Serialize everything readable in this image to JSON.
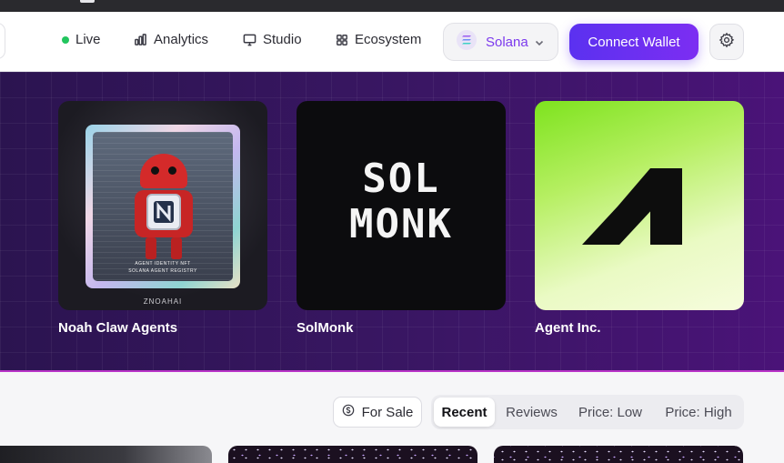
{
  "nav": {
    "live_label": "Live",
    "analytics_label": "Analytics",
    "studio_label": "Studio",
    "ecosystem_label": "Ecosystem",
    "chain_selected": "Solana",
    "connect_label": "Connect Wallet"
  },
  "featured": [
    {
      "title": "Noah Claw Agents",
      "art": {
        "caption_line1": "AGENT IDENTITY NFT",
        "caption_line2": "SOLANA AGENT REGISTRY",
        "watermark": "ZNOAHAI"
      }
    },
    {
      "title": "SolMonk",
      "art": {
        "line1": "SOL",
        "line2": "MONK"
      }
    },
    {
      "title": "Agent Inc."
    }
  ],
  "filters": {
    "for_sale_label": "For Sale",
    "sort_options": [
      "Recent",
      "Reviews",
      "Price: Low",
      "Price: High"
    ],
    "active_sort": "Recent"
  },
  "colors": {
    "accent": "#6d32f0",
    "live_dot": "#22c55e",
    "hero_bg": "#3a1664",
    "chain_text": "#7c3aed"
  },
  "icons": {
    "analytics": "bar-chart-icon",
    "studio": "monitor-icon",
    "ecosystem": "grid-icon",
    "chain": "solana-icon",
    "settings": "gear-icon",
    "for_sale": "dollar-circle-icon"
  }
}
